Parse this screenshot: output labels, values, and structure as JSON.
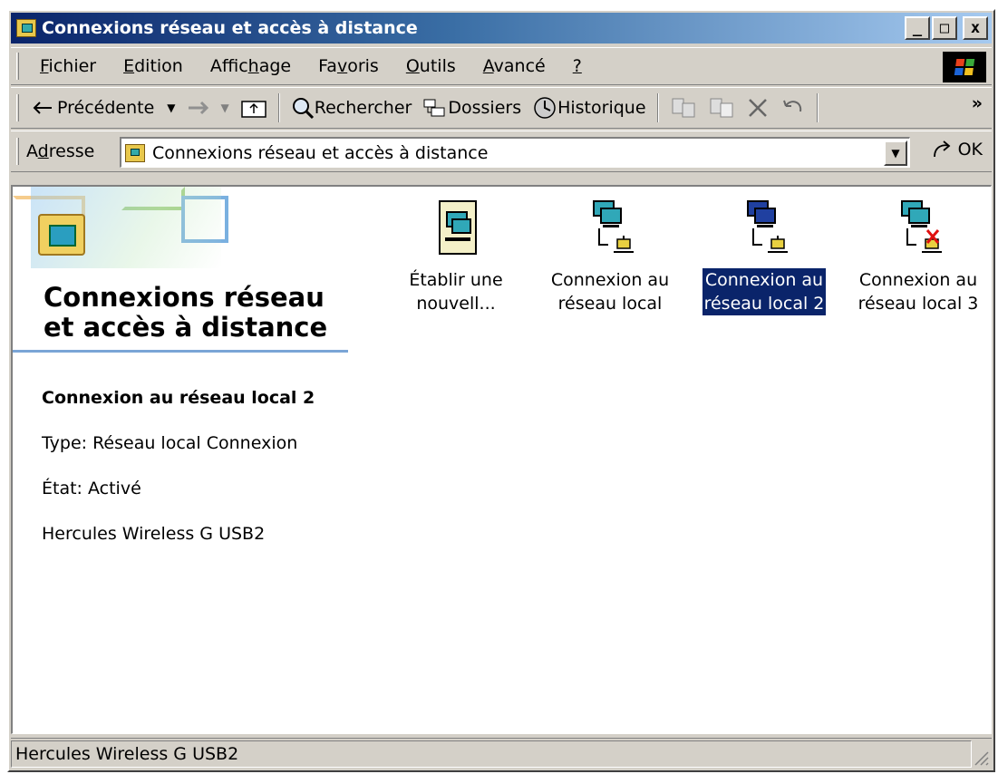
{
  "window": {
    "title": "Connexions réseau et accès à distance",
    "minimize_label": "_",
    "maximize_label": "□",
    "close_label": "x"
  },
  "menubar": {
    "items": [
      {
        "accel": "F",
        "rest": "ichier"
      },
      {
        "accel": "E",
        "rest": "dition"
      },
      {
        "pre": "Affic",
        "accel": "h",
        "rest": "age"
      },
      {
        "pre": "Fa",
        "accel": "v",
        "rest": "oris"
      },
      {
        "accel": "O",
        "rest": "utils"
      },
      {
        "accel": "A",
        "rest": "vancé"
      },
      {
        "accel": "?",
        "rest": ""
      }
    ]
  },
  "toolbar": {
    "back_label": "Précédente",
    "search_label": "Rechercher",
    "folders_label": "Dossiers",
    "history_label": "Historique",
    "chevron": "»"
  },
  "address": {
    "label_accel": "d",
    "label_pre": "A",
    "label_rest": "resse",
    "value": "Connexions réseau et accès à distance",
    "go_label": "OK"
  },
  "leftpane": {
    "title": "Connexions réseau et accès à distance",
    "selected_name": "Connexion au réseau local 2",
    "type_line": "Type: Réseau local Connexion",
    "state_line": "État: Activé",
    "device_line": "Hercules Wireless G USB2"
  },
  "icons": [
    {
      "line1": "Établir une",
      "line2": "nouvell...",
      "icon": "new-connection-icon",
      "selected": false
    },
    {
      "line1": "Connexion au",
      "line2": "réseau local",
      "icon": "lan-connection-icon",
      "selected": false
    },
    {
      "line1": "Connexion au",
      "line2": "réseau local 2",
      "icon": "lan-connection-icon",
      "selected": true
    },
    {
      "line1": "Connexion au",
      "line2": "réseau local 3",
      "icon": "lan-disconnected-icon",
      "selected": false
    }
  ],
  "statusbar": {
    "text": "Hercules Wireless G USB2"
  },
  "colors": {
    "title_start": "#0a246a",
    "selection": "#0a246a",
    "accent_rule": "#7aa5d6",
    "error_x": "#e01010"
  }
}
